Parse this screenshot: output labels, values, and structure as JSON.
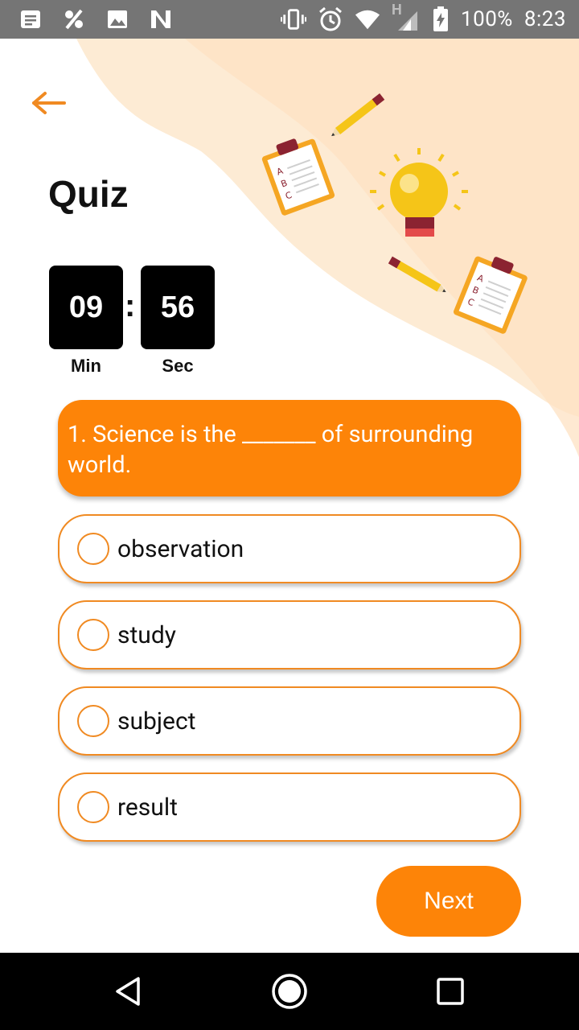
{
  "status_bar": {
    "battery": "100%",
    "time": "8:23",
    "network_type": "H"
  },
  "header": {
    "title": "Quiz",
    "back_icon": "arrow-left-icon"
  },
  "timer": {
    "minutes": "09",
    "seconds": "56",
    "separator": ":",
    "min_label": "Min",
    "sec_label": "Sec"
  },
  "question": {
    "text": "1. Science is the _______ of surrounding world."
  },
  "options": [
    {
      "label": "observation"
    },
    {
      "label": "study"
    },
    {
      "label": "subject"
    },
    {
      "label": "result"
    }
  ],
  "next_label": "Next",
  "colors": {
    "accent": "#fd8408",
    "border": "#f08a22",
    "status_bar": "#757575",
    "nav_bar": "#000000"
  }
}
